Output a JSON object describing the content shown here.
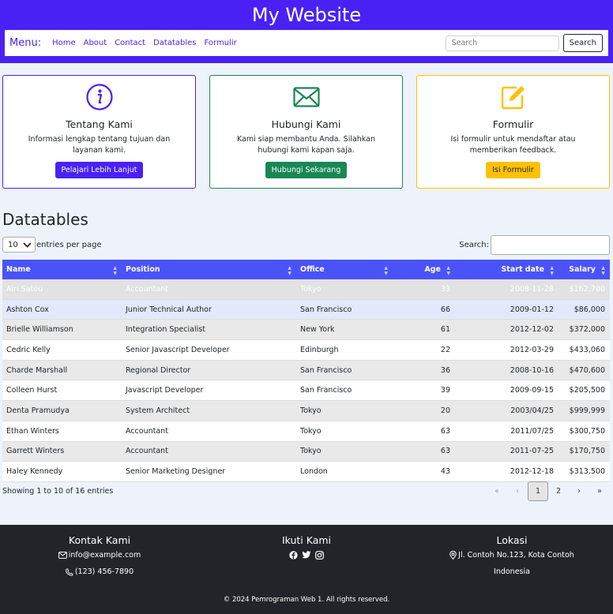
{
  "site_title": "My Website",
  "nav": {
    "brand": "Menu:",
    "links": [
      "Home",
      "About",
      "Contact",
      "Datatables",
      "Formulir"
    ],
    "search_placeholder": "Search",
    "search_button": "Search"
  },
  "cards": [
    {
      "icon": "info-icon",
      "title": "Tentang Kami",
      "text": "Informasi lengkap tentang tujuan dan layanan kami.",
      "button": "Pelajari Lebih Lanjut",
      "color": "#4a21f5"
    },
    {
      "icon": "envelope-icon",
      "title": "Hubungi Kami",
      "text": "Kami siap membantu Anda. Silahkan hubungi kami kapan saja.",
      "button": "Hubungi Sekarang",
      "color": "#198754"
    },
    {
      "icon": "edit-icon",
      "title": "Formulir",
      "text": "Isi formulir untuk mendaftar atau memberikan feedback.",
      "button": "Isi Formulir",
      "color": "#ffc107"
    }
  ],
  "datatable": {
    "title": "Datatables",
    "length_value": "10",
    "length_label": "entries per page",
    "search_label": "Search:",
    "columns": [
      "Name",
      "Position",
      "Office",
      "Age",
      "Start date",
      "Salary"
    ],
    "rows": [
      [
        "Airi Satou",
        "Accountant",
        "Tokyo",
        "33",
        "2008-11-28",
        "$162,700"
      ],
      [
        "Ashton Cox",
        "Junior Technical Author",
        "San Francisco",
        "66",
        "2009-01-12",
        "$86,000"
      ],
      [
        "Brielle Williamson",
        "Integration Specialist",
        "New York",
        "61",
        "2012-12-02",
        "$372,000"
      ],
      [
        "Cedric Kelly",
        "Senior Javascript Developer",
        "Edinburgh",
        "22",
        "2012-03-29",
        "$433,060"
      ],
      [
        "Charde Marshall",
        "Regional Director",
        "San Francisco",
        "36",
        "2008-10-16",
        "$470,600"
      ],
      [
        "Colleen Hurst",
        "Javascript Developer",
        "San Francisco",
        "39",
        "2009-09-15",
        "$205,500"
      ],
      [
        "Denta Pramudya",
        "System Architect",
        "Tokyo",
        "20",
        "2003/04/25",
        "$999,999"
      ],
      [
        "Ethan Winters",
        "Accountant",
        "Tokyo",
        "63",
        "2011/07/25",
        "$300,750"
      ],
      [
        "Garrett Winters",
        "Accountant",
        "Tokyo",
        "63",
        "2011-07-25",
        "$170,750"
      ],
      [
        "Haley Kennedy",
        "Senior Marketing Designer",
        "London",
        "43",
        "2012-12-18",
        "$313,500"
      ]
    ],
    "info": "Showing 1 to 10 of 16 entries",
    "pager": {
      "first": "«",
      "prev": "‹",
      "pages": [
        "1",
        "2"
      ],
      "next": "›",
      "last": "»"
    }
  },
  "footer": {
    "contact_title": "Kontak Kami",
    "email": "info@example.com",
    "phone": "(123) 456-7890",
    "follow_title": "Ikuti Kami",
    "location_title": "Lokasi",
    "address": "Jl. Contoh No.123, Kota Contoh",
    "country": "Indonesia",
    "copyright": "© 2024 Pemrograman Web 1. All rights reserved."
  },
  "colors": {
    "brand": "#4a21f5",
    "table_header": "#4a53f8",
    "footer_bg": "#212529"
  }
}
